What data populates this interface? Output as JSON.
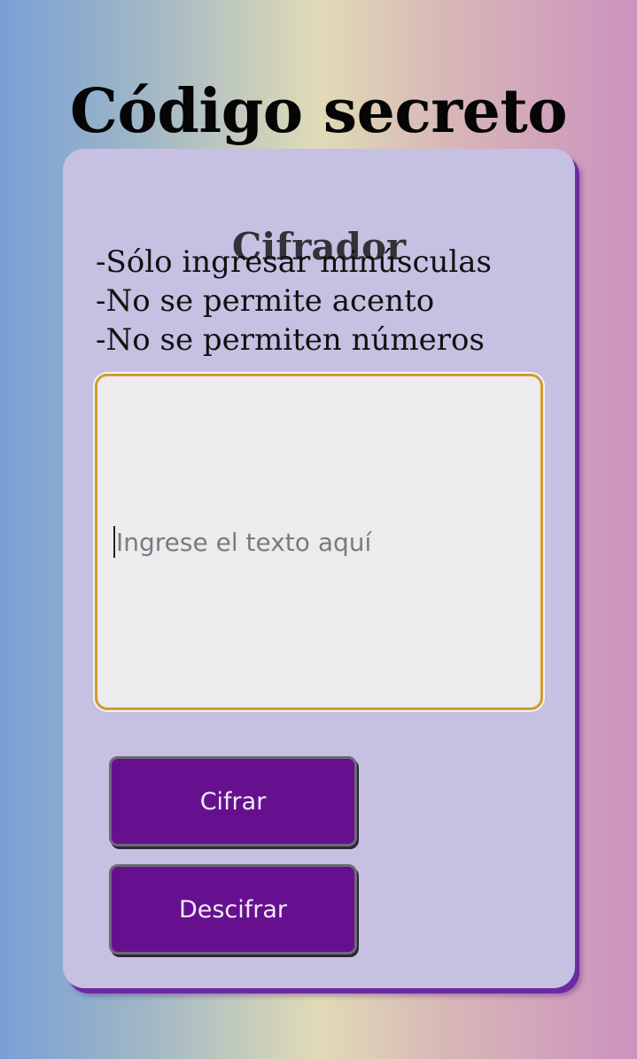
{
  "page": {
    "title": "Código secreto"
  },
  "card": {
    "title": "Cifrador",
    "rules": [
      "-Sólo ingresar minúsculas",
      "-No se permite acento",
      "-No se permiten números"
    ],
    "input": {
      "value": "",
      "placeholder": "Ingrese el texto aquí"
    },
    "buttons": {
      "encrypt_label": "Cifrar",
      "decrypt_label": "Descifrar"
    }
  },
  "colors": {
    "card_background": "#c6c0e3",
    "button_background": "#661090",
    "input_border": "#d29b2a",
    "card_shadow": "#6a2ba0"
  }
}
